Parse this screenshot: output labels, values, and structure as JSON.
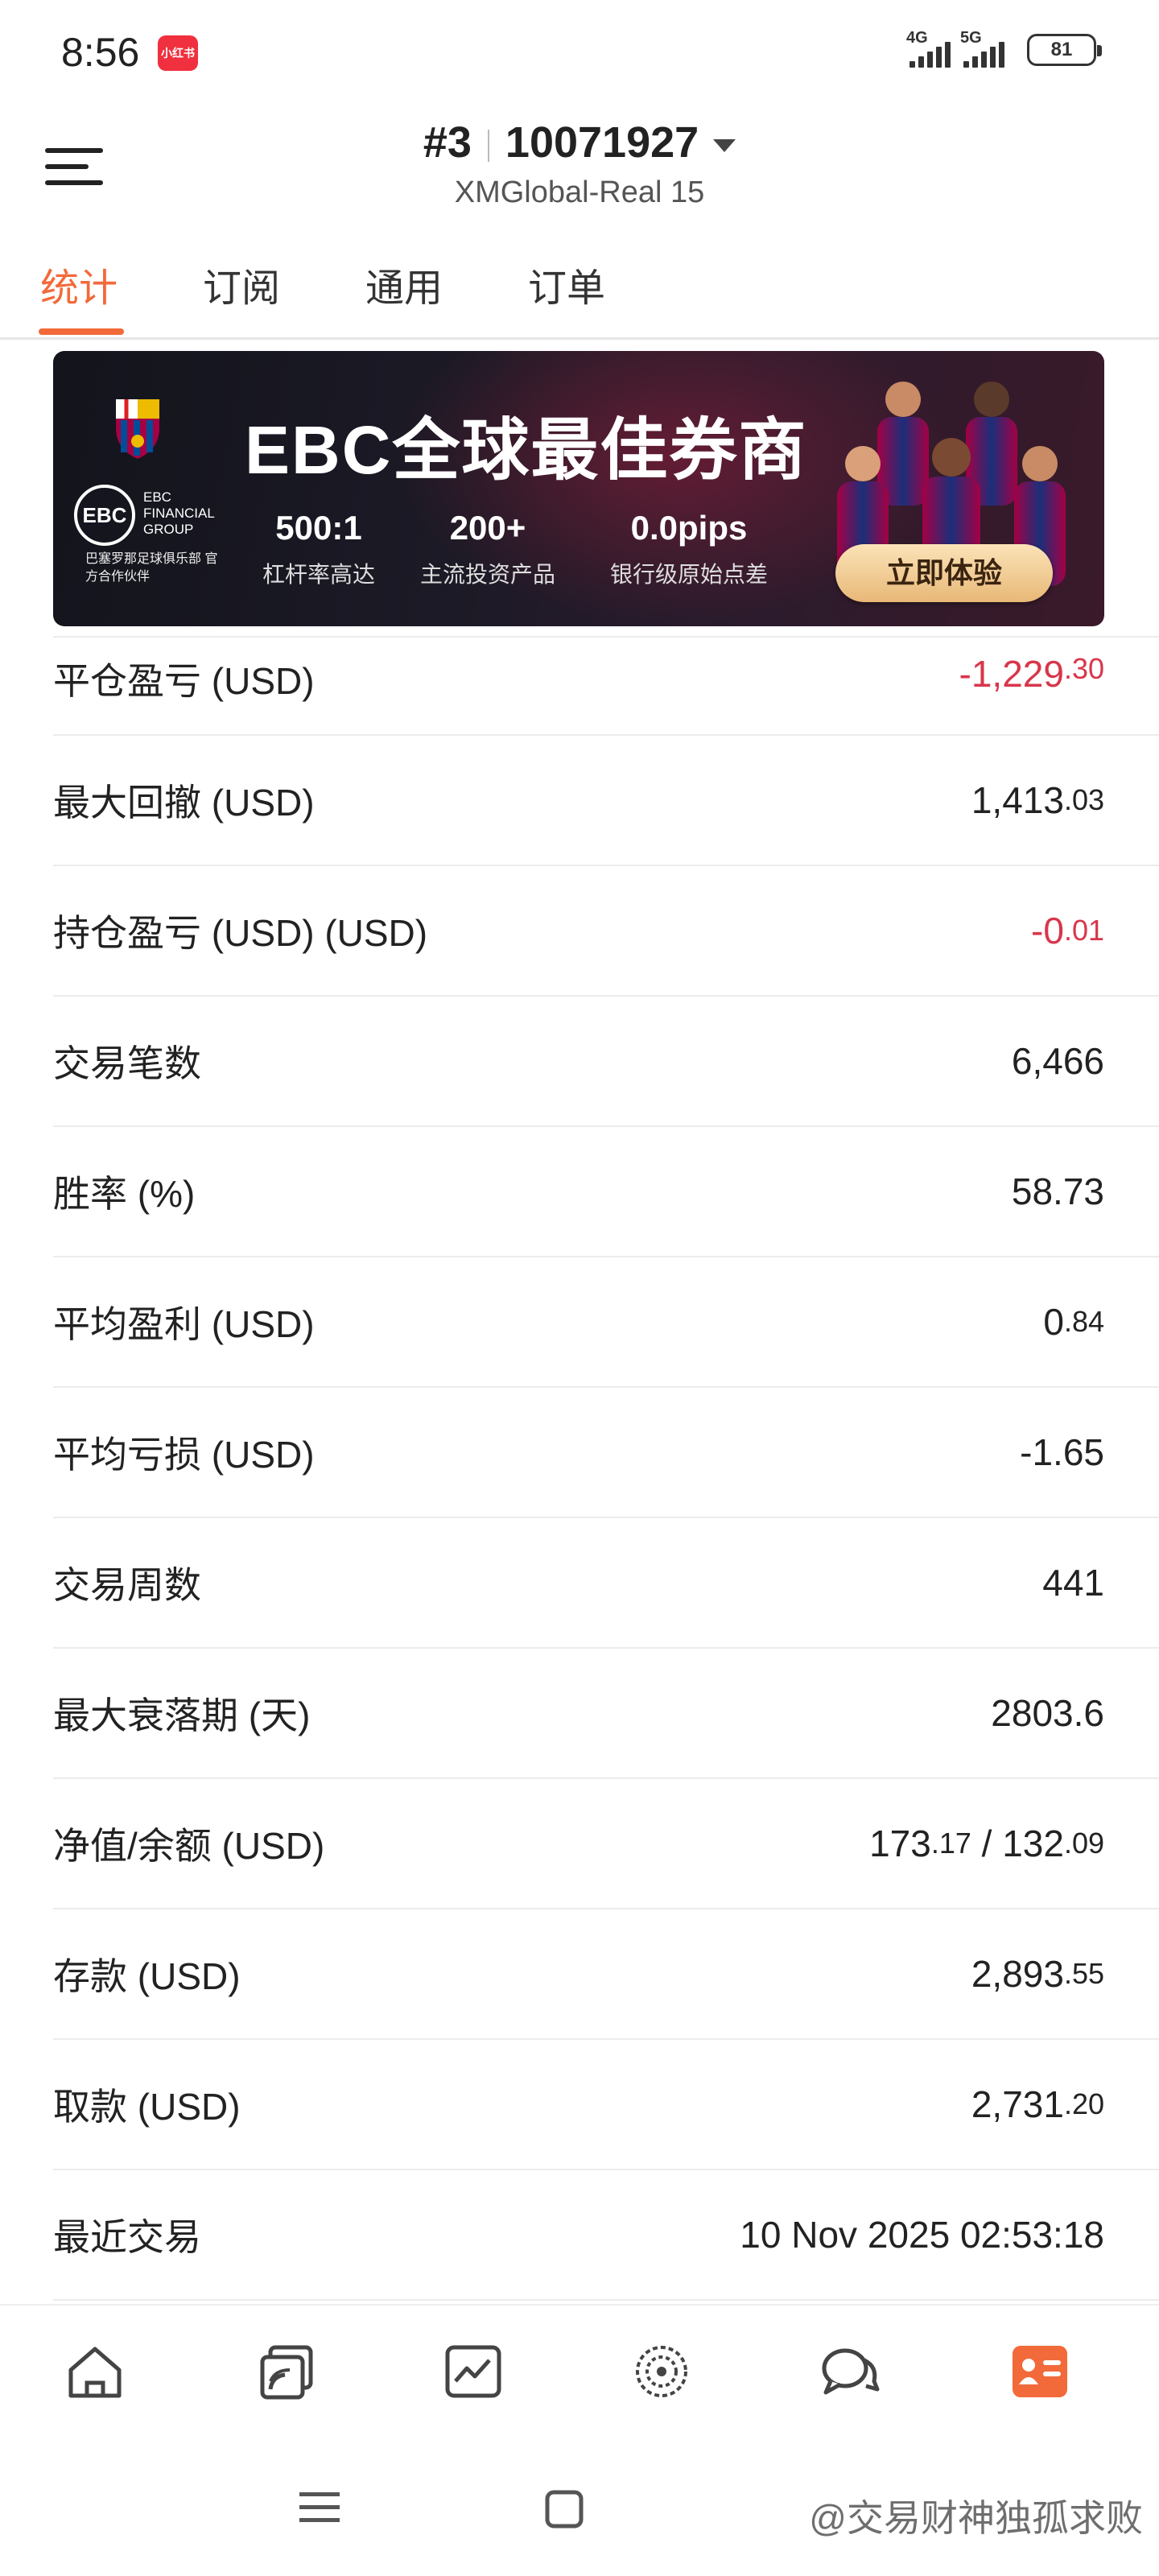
{
  "status_bar": {
    "time": "8:56",
    "app_badge": "小红书",
    "network_1": "4G",
    "network_2": "5G",
    "battery": "81"
  },
  "header": {
    "account_number": "#3",
    "account_id": "10071927",
    "server": "XMGlobal-Real 15"
  },
  "tabs": [
    {
      "label": "统计",
      "active": true
    },
    {
      "label": "订阅",
      "active": false
    },
    {
      "label": "通用",
      "active": false
    },
    {
      "label": "订单",
      "active": false
    }
  ],
  "banner": {
    "headline": "EBC全球最佳券商",
    "logo_text": "EBC FINANCIAL GROUP",
    "partner_text": "巴塞罗那足球俱乐部 官方合作伙伴",
    "stats": [
      {
        "value": "500:1",
        "label": "杠杆率高达"
      },
      {
        "value": "200+",
        "label": "主流投资产品"
      },
      {
        "value": "0.0pips",
        "label": "银行级原始点差"
      }
    ],
    "cta": "立即体验"
  },
  "stats": [
    {
      "label": "平仓盈亏 (USD)",
      "int": "-1,229",
      "dec": ".30",
      "negative": true
    },
    {
      "label": "最大回撤 (USD)",
      "int": "1,413",
      "dec": ".03",
      "negative": false
    },
    {
      "label": "持仓盈亏 (USD) (USD)",
      "int": "-0",
      "dec": ".01",
      "negative": true
    },
    {
      "label": "交易笔数",
      "int": "6,466",
      "dec": "",
      "negative": false
    },
    {
      "label": "胜率 (%)",
      "int": "58.73",
      "dec": "",
      "negative": false
    },
    {
      "label": "平均盈利 (USD)",
      "int": "0",
      "dec": ".84",
      "negative": false
    },
    {
      "label": "平均亏损 (USD)",
      "int": "-1.65",
      "dec": "",
      "negative": false
    },
    {
      "label": "交易周数",
      "int": "441",
      "dec": "",
      "negative": false
    },
    {
      "label": "最大衰落期 (天)",
      "int": "2803.6",
      "dec": "",
      "negative": false
    },
    {
      "label": "净值/余额 (USD)",
      "int": "173",
      "dec": ".17",
      "int2": " / 132",
      "dec2": ".09",
      "negative": false
    },
    {
      "label": "存款 (USD)",
      "int": "2,893",
      "dec": ".55",
      "negative": false
    },
    {
      "label": "取款 (USD)",
      "int": "2,731",
      "dec": ".20",
      "negative": false
    },
    {
      "label": "最近交易",
      "int": "10 Nov 2025 02:53:18",
      "dec": "",
      "negative": false
    }
  ],
  "bottom_nav": [
    {
      "icon": "home-icon"
    },
    {
      "icon": "copy-trading-icon"
    },
    {
      "icon": "chart-icon"
    },
    {
      "icon": "discover-icon"
    },
    {
      "icon": "chat-icon"
    },
    {
      "icon": "profile-card-icon",
      "active": true
    }
  ],
  "watermark": "@交易财神独孤求败",
  "colors": {
    "accent": "#f26a3a",
    "negative": "#d8364b"
  }
}
